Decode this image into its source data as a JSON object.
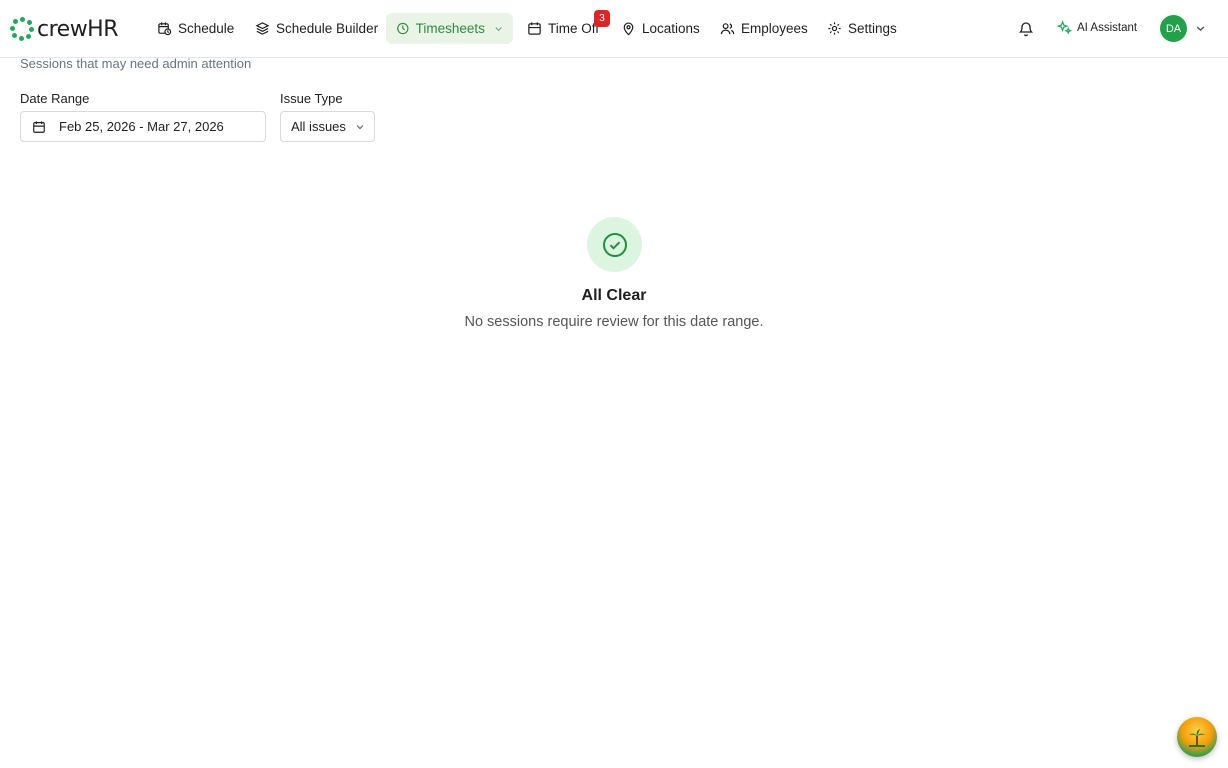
{
  "app": {
    "logo_text": "crewHR"
  },
  "nav": {
    "items": [
      {
        "label": "Schedule",
        "icon": "calendar-clock-icon"
      },
      {
        "label": "Schedule Builder",
        "icon": "layers-icon"
      },
      {
        "label": "Timesheets",
        "icon": "clock-icon",
        "active": true
      },
      {
        "label": "Time Off",
        "icon": "calendar-icon",
        "badge": "3"
      },
      {
        "label": "Locations",
        "icon": "map-pin-icon"
      },
      {
        "label": "Employees",
        "icon": "users-icon"
      },
      {
        "label": "Settings",
        "icon": "gear-icon"
      }
    ]
  },
  "header": {
    "ai_label": "AI Assistant",
    "avatar_initials": "DA"
  },
  "page": {
    "subtitle": "Sessions that may need admin attention"
  },
  "filters": {
    "date_range_label": "Date Range",
    "date_range_value": "Feb 25, 2026 - Mar 27, 2026",
    "issue_type_label": "Issue Type",
    "issue_type_value": "All issues"
  },
  "empty_state": {
    "title": "All Clear",
    "message": "No sessions require review for this date range."
  },
  "colors": {
    "accent": "#2e8b3d",
    "badge": "#dc2626",
    "avatar": "#22a04a"
  }
}
